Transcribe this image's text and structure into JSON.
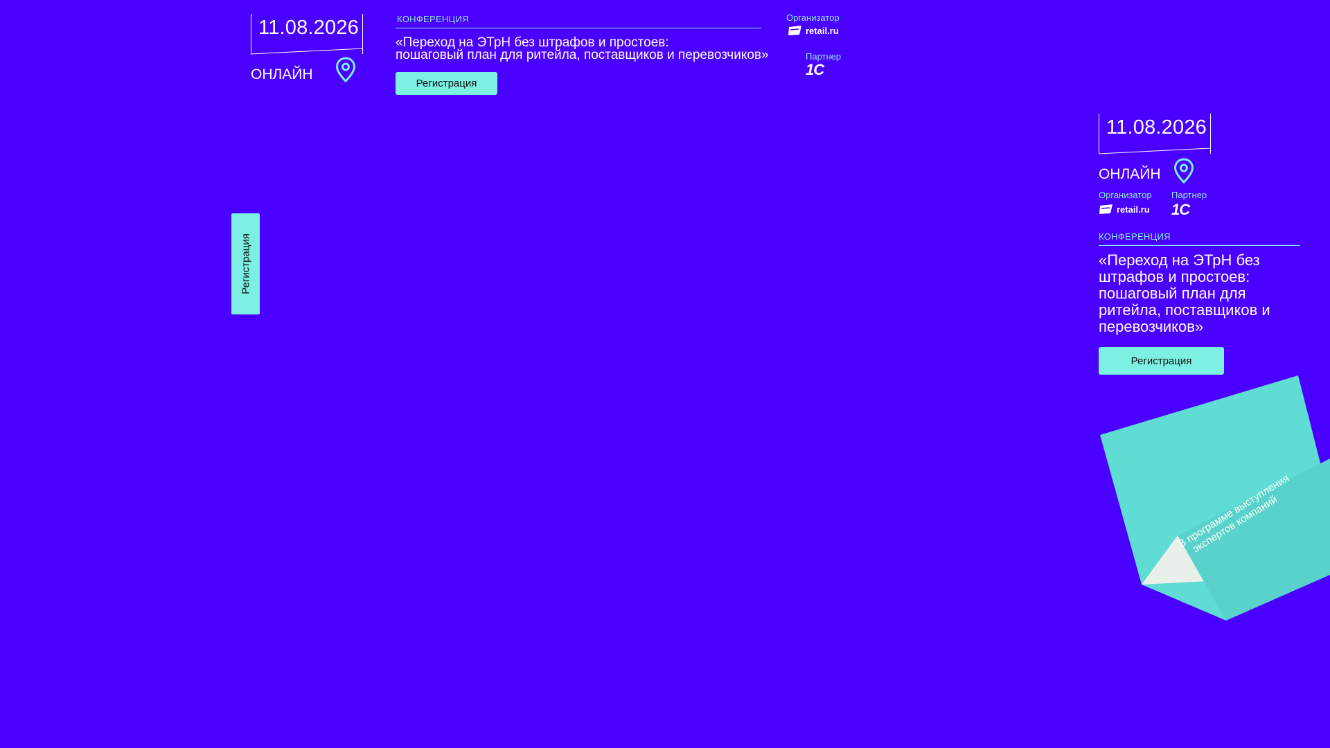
{
  "event": {
    "date": "11.08.2026",
    "format": "ОНЛАЙН",
    "category": "КОНФЕРЕНЦИЯ",
    "title_line1": "«Переход на ЭТрН без штрафов и простоев:",
    "title_line2": "пошаговый план для ритейла, поставщиков и перевозчиков»",
    "title_full": "«Переход на ЭТрН без штрафов и простоев: пошаговый план для ритейла, поставщиков и перевозчиков»"
  },
  "organizer": {
    "label": "Организатор",
    "logo_text": "retail.ru"
  },
  "partner": {
    "label": "Партнер",
    "logo_text": "1С"
  },
  "register_button": {
    "label": "Регистрация"
  },
  "side_tab": {
    "label": "Регистрация"
  },
  "promo": {
    "line1": "В программе выступления",
    "line2": "экспертов компаний"
  },
  "colors": {
    "background": "#4a00ff",
    "accent": "#7cf0e2",
    "paper": "#5fdcd4",
    "paper_shadow": "#e9efe9"
  },
  "icons": {
    "location": "map-pin-icon",
    "organizer_logo": "retail-logo-icon",
    "partner_logo": "one-c-logo-icon"
  }
}
